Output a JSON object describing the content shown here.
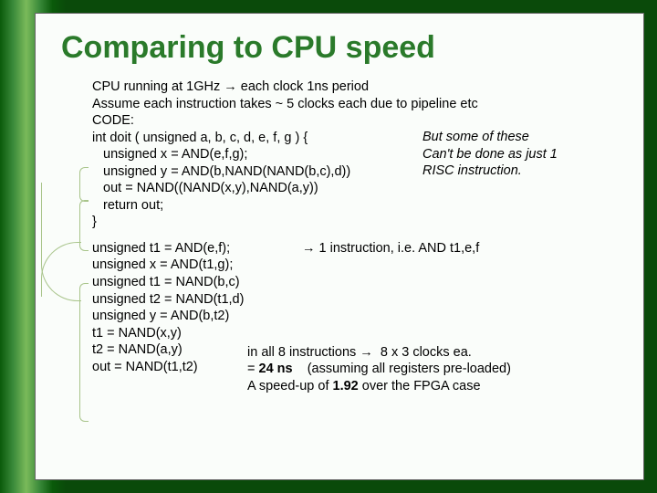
{
  "title": "Comparing to CPU speed",
  "block1": {
    "l1": "CPU running at 1GHz → each clock 1ns period",
    "l2": "Assume each instruction takes ~ 5 clocks each due to pipeline etc",
    "l3": "CODE:",
    "l4": "int doit ( unsigned a, b, c, d, e, f, g ) {",
    "l5": " unsigned x = AND(e,f,g);",
    "l6": " unsigned y = AND(b,NAND(NAND(b,c),d))",
    "l7": " out = NAND((NAND(x,y),NAND(a,y))",
    "l8": " return out;",
    "l9": "}"
  },
  "aside": {
    "a1": "But some of these",
    "a2": "Can't be done as just 1",
    "a3": "RISC instruction."
  },
  "block2": {
    "b1": "unsigned t1 = AND(e,f);",
    "b2": "unsigned x = AND(t1,g);",
    "b3": "unsigned t1 = NAND(b,c)",
    "b4": "unsigned t2 = NAND(t1,d)",
    "b5": "unsigned y = AND(b,t2)",
    "b6": "t1 = NAND(x,y)",
    "b7": "t2 = NAND(a,y)",
    "b8": "out = NAND(t1,t2)"
  },
  "note1": "→  1 instruction, i.e. AND t1,e,f",
  "summary": {
    "s1": "in all 8 instructions →  8 x 3 clocks ea.",
    "s2_a": "= ",
    "s2_b": "24 ns",
    "s2_c": "    (assuming all registers pre-loaded)",
    "s3_a": "A speed-up of ",
    "s3_b": "1.92",
    "s3_c": " over the FPGA case"
  }
}
